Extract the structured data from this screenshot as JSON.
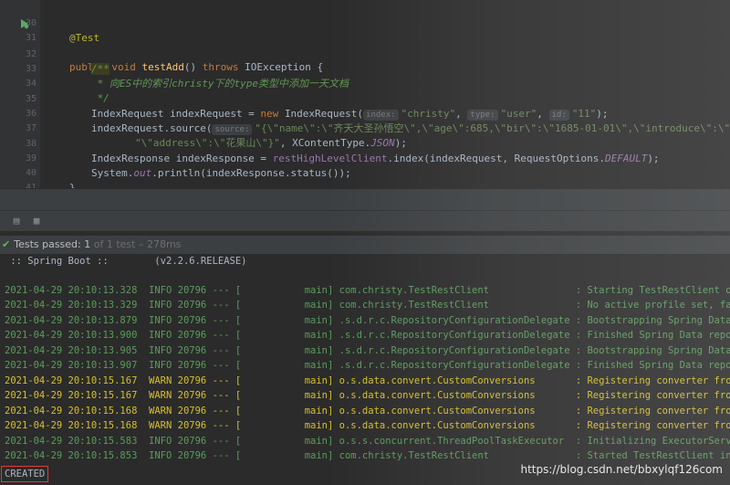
{
  "editor": {
    "lines": {
      "l30": {
        "num": "30",
        "annotation": "@Test"
      },
      "l31": {
        "num": "31",
        "kw1": "public void ",
        "fn": "testAdd",
        "rest": "() ",
        "kw2": "throws ",
        "tail": "IOException {"
      },
      "l32": {
        "num": "32",
        "cmt": "/**"
      },
      "l33": {
        "num": "33",
        "cmt": " * 向ES中的索引christy下的type类型中添加一天文档"
      },
      "l34": {
        "num": "34",
        "cmt": " */"
      },
      "l35": {
        "num": "35",
        "a": "IndexRequest indexRequest = ",
        "kw": "new ",
        "b": "IndexRequest(",
        "h1": "index:",
        "s1": "\"christy\"",
        "c1": ", ",
        "h2": "type:",
        "s2": "\"user\"",
        "c2": ", ",
        "h3": "id:",
        "s3": "\"11\"",
        "end": ");"
      },
      "l36": {
        "num": "36",
        "a": "indexRequest.source(",
        "h1": "source:",
        "s1": "\"{\\\"name\\\":\\\"齐天大圣孙悟空\\\",\\\"age\\\":685,\\\"bir\\\":\\\"1685-01-01\\\",\\\"introduce\\\":\\\"花果山水帘"
      },
      "l37": {
        "num": "37",
        "s1": "\"\\\"address\\\":\\\"花果山\\\"}\"",
        "b": ", XContentType.",
        "fld": "JSON",
        "end": ");"
      },
      "l38": {
        "num": "38",
        "a": "IndexResponse indexResponse = ",
        "fld1": "restHighLevelClient",
        "b": ".index(indexRequest, RequestOptions.",
        "fld2": "DEFAULT",
        "end": ");"
      },
      "l39": {
        "num": "39",
        "a": "System.",
        "fld": "out",
        "b": ".println(indexResponse.status());"
      },
      "l40": {
        "num": "40",
        "a": "}"
      },
      "l41": {
        "num": "41",
        "a": "}"
      }
    }
  },
  "status": {
    "label": "Tests passed:",
    "passed": "1",
    "of": "of 1 test",
    "time": "– 278ms"
  },
  "console": {
    "banner": " :: Spring Boot ::        (v2.2.6.RELEASE)",
    "logs": [
      {
        "text": "2021-04-29 20:10:13.328  INFO 20796 --- [           main] com.christy.TestRestClient               : Starting TestRestClient on DES",
        "level": "info"
      },
      {
        "text": "2021-04-29 20:10:13.329  INFO 20796 --- [           main] com.christy.TestRestClient               : No active profile set, falling",
        "level": "info"
      },
      {
        "text": "2021-04-29 20:10:13.879  INFO 20796 --- [           main] .s.d.r.c.RepositoryConfigurationDelegate : Bootstrapping Spring Data Elas",
        "level": "info"
      },
      {
        "text": "2021-04-29 20:10:13.900  INFO 20796 --- [           main] .s.d.r.c.RepositoryConfigurationDelegate : Finished Spring Data repositor",
        "level": "info"
      },
      {
        "text": "2021-04-29 20:10:13.905  INFO 20796 --- [           main] .s.d.r.c.RepositoryConfigurationDelegate : Bootstrapping Spring Data Reac",
        "level": "info"
      },
      {
        "text": "2021-04-29 20:10:13.907  INFO 20796 --- [           main] .s.d.r.c.RepositoryConfigurationDelegate : Finished Spring Data repositor",
        "level": "info"
      },
      {
        "text": "2021-04-29 20:10:15.167  WARN 20796 --- [           main] o.s.data.convert.CustomConversions       : Registering converter from cla",
        "level": "warn"
      },
      {
        "text": "2021-04-29 20:10:15.167  WARN 20796 --- [           main] o.s.data.convert.CustomConversions       : Registering converter from int",
        "level": "warn"
      },
      {
        "text": "2021-04-29 20:10:15.168  WARN 20796 --- [           main] o.s.data.convert.CustomConversions       : Registering converter from cla",
        "level": "warn"
      },
      {
        "text": "2021-04-29 20:10:15.168  WARN 20796 --- [           main] o.s.data.convert.CustomConversions       : Registering converter from int",
        "level": "warn"
      },
      {
        "text": "2021-04-29 20:10:15.583  INFO 20796 --- [           main] o.s.s.concurrent.ThreadPoolTaskExecutor  : Initializing ExecutorService '",
        "level": "info"
      },
      {
        "text": "2021-04-29 20:10:15.853  INFO 20796 --- [           main] com.christy.TestRestClient               : Started TestRestClient in 2.77",
        "level": "info"
      }
    ],
    "result": "CREATED",
    "watermark": "https://blog.csdn.net/bbxylqf126com"
  }
}
